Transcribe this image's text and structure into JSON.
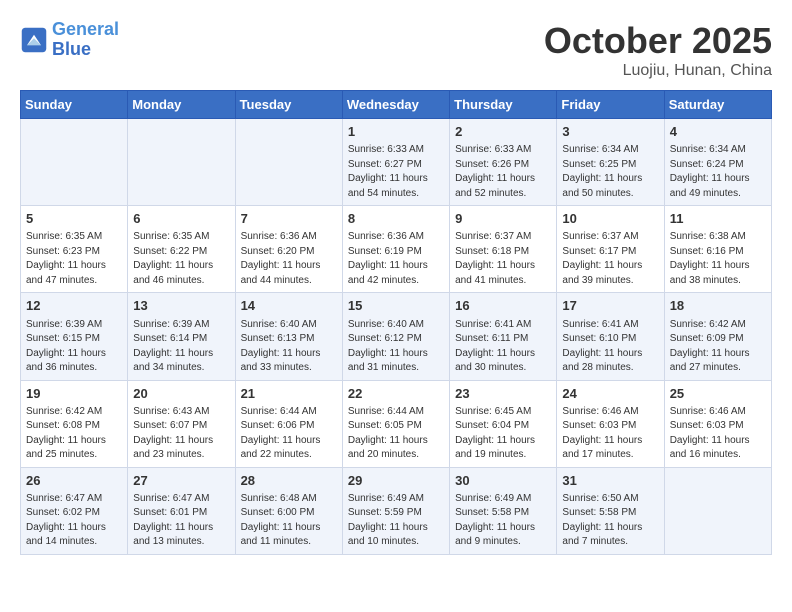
{
  "header": {
    "logo_line1": "General",
    "logo_line2": "Blue",
    "month": "October 2025",
    "location": "Luojiu, Hunan, China"
  },
  "weekdays": [
    "Sunday",
    "Monday",
    "Tuesday",
    "Wednesday",
    "Thursday",
    "Friday",
    "Saturday"
  ],
  "weeks": [
    [
      {
        "day": "",
        "info": ""
      },
      {
        "day": "",
        "info": ""
      },
      {
        "day": "",
        "info": ""
      },
      {
        "day": "1",
        "info": "Sunrise: 6:33 AM\nSunset: 6:27 PM\nDaylight: 11 hours\nand 54 minutes."
      },
      {
        "day": "2",
        "info": "Sunrise: 6:33 AM\nSunset: 6:26 PM\nDaylight: 11 hours\nand 52 minutes."
      },
      {
        "day": "3",
        "info": "Sunrise: 6:34 AM\nSunset: 6:25 PM\nDaylight: 11 hours\nand 50 minutes."
      },
      {
        "day": "4",
        "info": "Sunrise: 6:34 AM\nSunset: 6:24 PM\nDaylight: 11 hours\nand 49 minutes."
      }
    ],
    [
      {
        "day": "5",
        "info": "Sunrise: 6:35 AM\nSunset: 6:23 PM\nDaylight: 11 hours\nand 47 minutes."
      },
      {
        "day": "6",
        "info": "Sunrise: 6:35 AM\nSunset: 6:22 PM\nDaylight: 11 hours\nand 46 minutes."
      },
      {
        "day": "7",
        "info": "Sunrise: 6:36 AM\nSunset: 6:20 PM\nDaylight: 11 hours\nand 44 minutes."
      },
      {
        "day": "8",
        "info": "Sunrise: 6:36 AM\nSunset: 6:19 PM\nDaylight: 11 hours\nand 42 minutes."
      },
      {
        "day": "9",
        "info": "Sunrise: 6:37 AM\nSunset: 6:18 PM\nDaylight: 11 hours\nand 41 minutes."
      },
      {
        "day": "10",
        "info": "Sunrise: 6:37 AM\nSunset: 6:17 PM\nDaylight: 11 hours\nand 39 minutes."
      },
      {
        "day": "11",
        "info": "Sunrise: 6:38 AM\nSunset: 6:16 PM\nDaylight: 11 hours\nand 38 minutes."
      }
    ],
    [
      {
        "day": "12",
        "info": "Sunrise: 6:39 AM\nSunset: 6:15 PM\nDaylight: 11 hours\nand 36 minutes."
      },
      {
        "day": "13",
        "info": "Sunrise: 6:39 AM\nSunset: 6:14 PM\nDaylight: 11 hours\nand 34 minutes."
      },
      {
        "day": "14",
        "info": "Sunrise: 6:40 AM\nSunset: 6:13 PM\nDaylight: 11 hours\nand 33 minutes."
      },
      {
        "day": "15",
        "info": "Sunrise: 6:40 AM\nSunset: 6:12 PM\nDaylight: 11 hours\nand 31 minutes."
      },
      {
        "day": "16",
        "info": "Sunrise: 6:41 AM\nSunset: 6:11 PM\nDaylight: 11 hours\nand 30 minutes."
      },
      {
        "day": "17",
        "info": "Sunrise: 6:41 AM\nSunset: 6:10 PM\nDaylight: 11 hours\nand 28 minutes."
      },
      {
        "day": "18",
        "info": "Sunrise: 6:42 AM\nSunset: 6:09 PM\nDaylight: 11 hours\nand 27 minutes."
      }
    ],
    [
      {
        "day": "19",
        "info": "Sunrise: 6:42 AM\nSunset: 6:08 PM\nDaylight: 11 hours\nand 25 minutes."
      },
      {
        "day": "20",
        "info": "Sunrise: 6:43 AM\nSunset: 6:07 PM\nDaylight: 11 hours\nand 23 minutes."
      },
      {
        "day": "21",
        "info": "Sunrise: 6:44 AM\nSunset: 6:06 PM\nDaylight: 11 hours\nand 22 minutes."
      },
      {
        "day": "22",
        "info": "Sunrise: 6:44 AM\nSunset: 6:05 PM\nDaylight: 11 hours\nand 20 minutes."
      },
      {
        "day": "23",
        "info": "Sunrise: 6:45 AM\nSunset: 6:04 PM\nDaylight: 11 hours\nand 19 minutes."
      },
      {
        "day": "24",
        "info": "Sunrise: 6:46 AM\nSunset: 6:03 PM\nDaylight: 11 hours\nand 17 minutes."
      },
      {
        "day": "25",
        "info": "Sunrise: 6:46 AM\nSunset: 6:03 PM\nDaylight: 11 hours\nand 16 minutes."
      }
    ],
    [
      {
        "day": "26",
        "info": "Sunrise: 6:47 AM\nSunset: 6:02 PM\nDaylight: 11 hours\nand 14 minutes."
      },
      {
        "day": "27",
        "info": "Sunrise: 6:47 AM\nSunset: 6:01 PM\nDaylight: 11 hours\nand 13 minutes."
      },
      {
        "day": "28",
        "info": "Sunrise: 6:48 AM\nSunset: 6:00 PM\nDaylight: 11 hours\nand 11 minutes."
      },
      {
        "day": "29",
        "info": "Sunrise: 6:49 AM\nSunset: 5:59 PM\nDaylight: 11 hours\nand 10 minutes."
      },
      {
        "day": "30",
        "info": "Sunrise: 6:49 AM\nSunset: 5:58 PM\nDaylight: 11 hours\nand 9 minutes."
      },
      {
        "day": "31",
        "info": "Sunrise: 6:50 AM\nSunset: 5:58 PM\nDaylight: 11 hours\nand 7 minutes."
      },
      {
        "day": "",
        "info": ""
      }
    ]
  ]
}
